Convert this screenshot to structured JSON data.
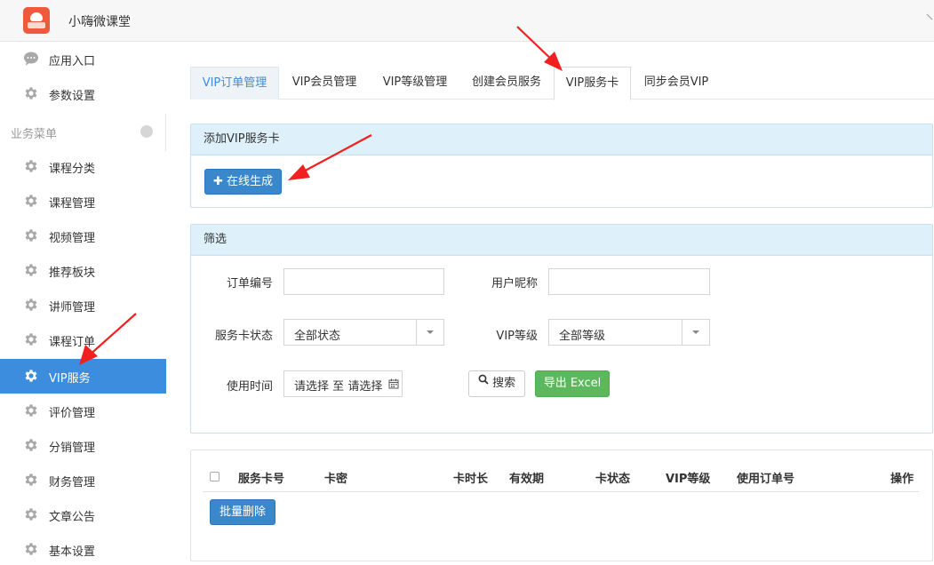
{
  "app": {
    "title": "小嗨微课堂"
  },
  "sidebar": {
    "top_items": [
      {
        "label": "应用入口",
        "icon": "chat-bubble-icon"
      },
      {
        "label": "参数设置",
        "icon": "gear-icon"
      }
    ],
    "section_label": "业务菜单",
    "items": [
      {
        "label": "课程分类",
        "icon": "gear-icon"
      },
      {
        "label": "课程管理",
        "icon": "gear-icon"
      },
      {
        "label": "视频管理",
        "icon": "gear-icon"
      },
      {
        "label": "推荐板块",
        "icon": "gear-icon"
      },
      {
        "label": "讲师管理",
        "icon": "gear-icon"
      },
      {
        "label": "课程订单",
        "icon": "gear-icon"
      },
      {
        "label": "VIP服务",
        "icon": "gear-icon",
        "active": true
      },
      {
        "label": "评价管理",
        "icon": "gear-icon"
      },
      {
        "label": "分销管理",
        "icon": "gear-icon"
      },
      {
        "label": "财务管理",
        "icon": "gear-icon"
      },
      {
        "label": "文章公告",
        "icon": "gear-icon"
      },
      {
        "label": "基本设置",
        "icon": "gear-icon"
      }
    ]
  },
  "tabs": [
    {
      "label": "VIP订单管理"
    },
    {
      "label": "VIP会员管理"
    },
    {
      "label": "VIP等级管理"
    },
    {
      "label": "创建会员服务"
    },
    {
      "label": "VIP服务卡",
      "active": true
    },
    {
      "label": "同步会员VIP"
    }
  ],
  "add_panel": {
    "title": "添加VIP服务卡",
    "generate_button": "在线生成"
  },
  "filter_panel": {
    "title": "筛选",
    "order_no_label": "订单编号",
    "nickname_label": "用户昵称",
    "card_status_label": "服务卡状态",
    "card_status_value": "全部状态",
    "vip_level_label": "VIP等级",
    "vip_level_value": "全部等级",
    "use_time_label": "使用时间",
    "date_start": "请选择",
    "date_sep": "至",
    "date_end": "请选择",
    "search_button": "搜索",
    "export_button": "导出 Excel"
  },
  "table": {
    "columns": [
      "服务卡号",
      "卡密",
      "卡时长",
      "有效期",
      "卡状态",
      "VIP等级",
      "使用订单号",
      "操作"
    ],
    "batch_delete_button": "批量删除"
  },
  "colors": {
    "accent": "#3c8dde",
    "panel_head": "#def0f9",
    "export_green": "#5cb85c",
    "annotation_arrow": "#f02020"
  }
}
